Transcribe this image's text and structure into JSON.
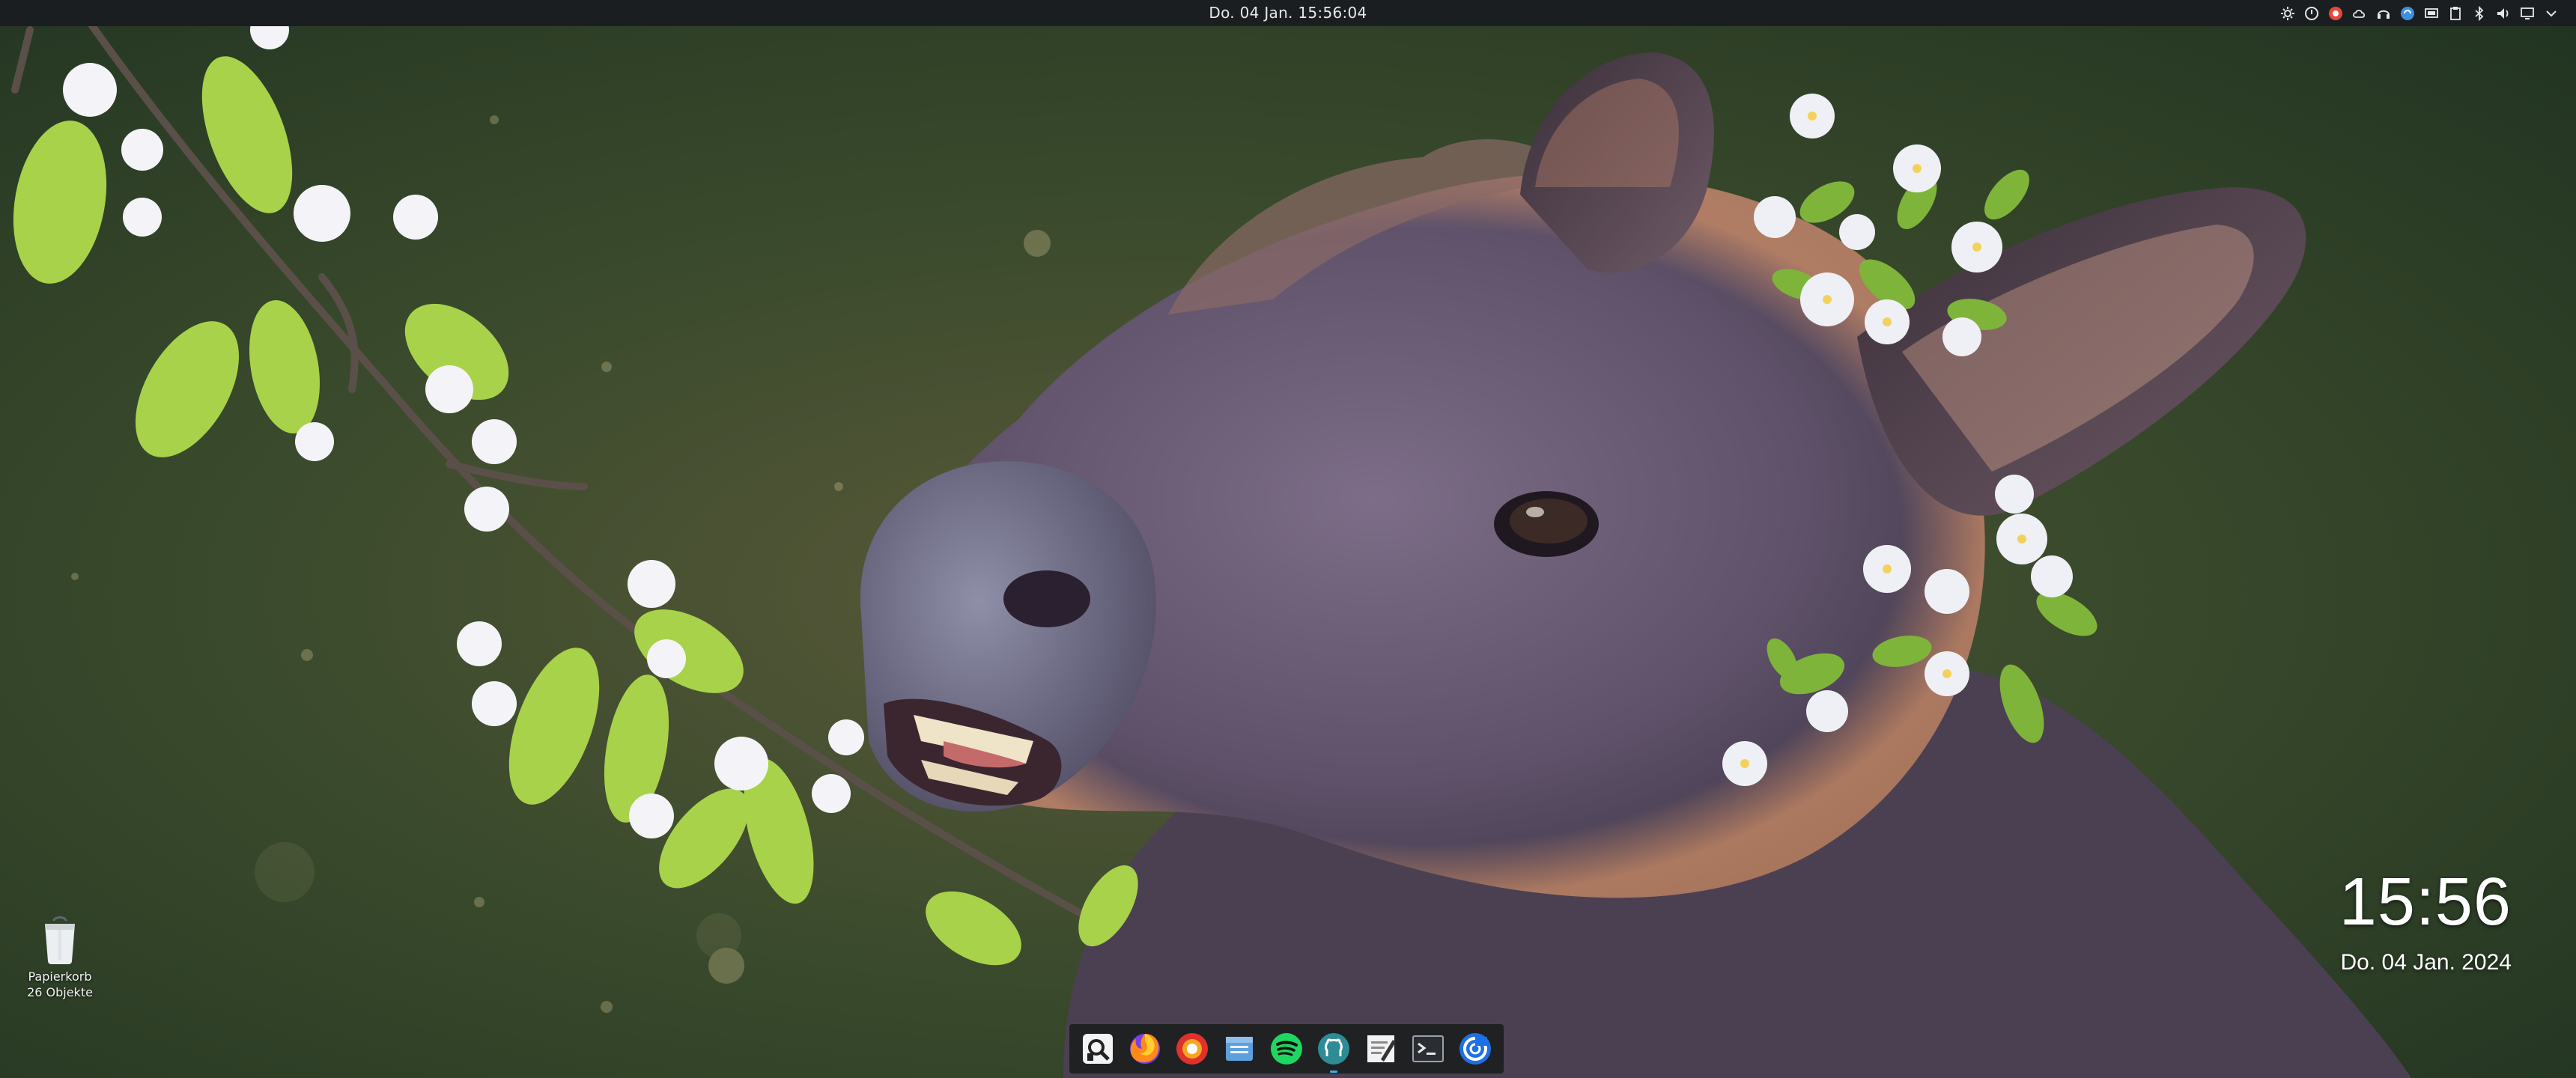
{
  "top_panel": {
    "clock": "Do. 04 Jan.  15:56:04",
    "tray_icons": [
      "settings-gear-icon",
      "power-icon",
      "record-icon",
      "cloud-icon",
      "headset-icon",
      "sync-icon",
      "display-icon",
      "clipboard-icon",
      "bluetooth-icon",
      "volume-icon",
      "screen-icon",
      "chevron-down-icon"
    ]
  },
  "desktop": {
    "trash": {
      "name": "Papierkorb",
      "count": "26 Objekte",
      "icon": "trash-bin-icon"
    },
    "clock_widget": {
      "time": "15:56",
      "date": "Do. 04 Jan. 2024"
    }
  },
  "dock": {
    "apps": [
      "app-launcher-icon",
      "firefox-icon",
      "record-app-icon",
      "files-icon",
      "spotify-icon",
      "github-desktop-icon",
      "text-editor-icon",
      "terminal-icon",
      "browser-icon"
    ]
  },
  "colors": {
    "panel_bg": "#1b1e20",
    "dock_bg": "#1c1e20",
    "accent": "#3daee9"
  }
}
